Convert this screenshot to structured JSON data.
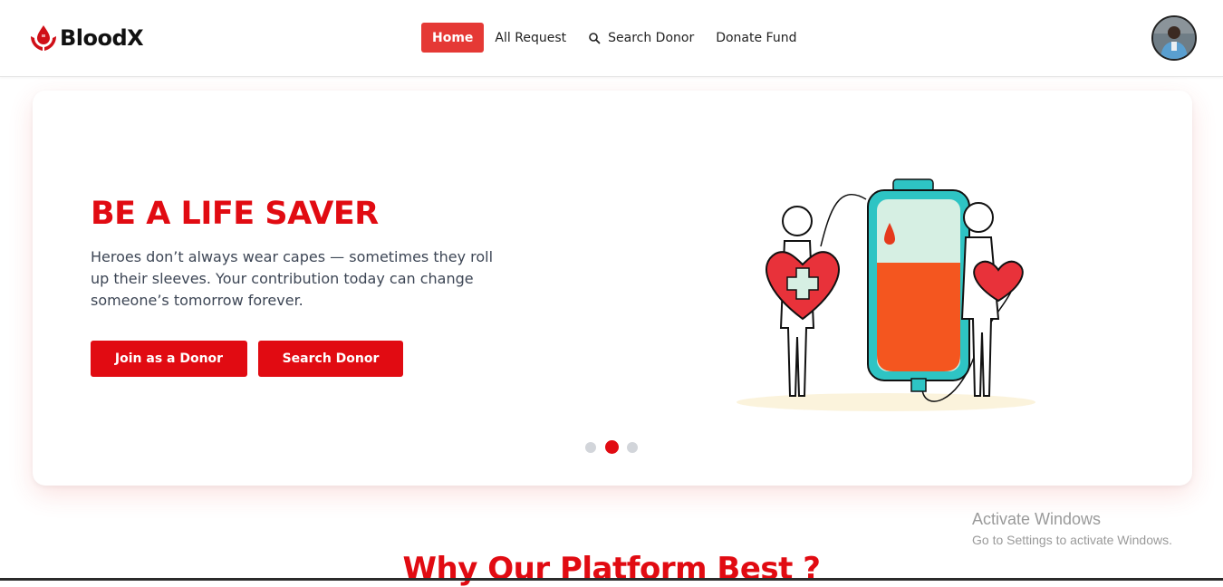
{
  "brand": {
    "name": "BloodX"
  },
  "nav": {
    "items": [
      {
        "label": "Home",
        "active": true
      },
      {
        "label": "All Request",
        "active": false
      },
      {
        "label": "Search Donor",
        "active": false,
        "icon": "search-icon"
      },
      {
        "label": "Donate Fund",
        "active": false
      }
    ]
  },
  "hero": {
    "title": "BE A LIFE SAVER",
    "text": "Heroes don’t always wear capes — sometimes they roll up their sleeves. Your contribution today can change someone’s tomorrow forever.",
    "buttons": {
      "join": "Join as a Donor",
      "search": "Search Donor"
    },
    "carousel": {
      "slides": 3,
      "active": 2
    }
  },
  "section": {
    "title": "Why Our Platform Best ?"
  },
  "watermark": {
    "title": "Activate Windows",
    "subtitle": "Go to Settings to activate Windows."
  },
  "colors": {
    "accent": "#e10b12",
    "nav_active": "#e53935",
    "text": "#3d4655"
  }
}
